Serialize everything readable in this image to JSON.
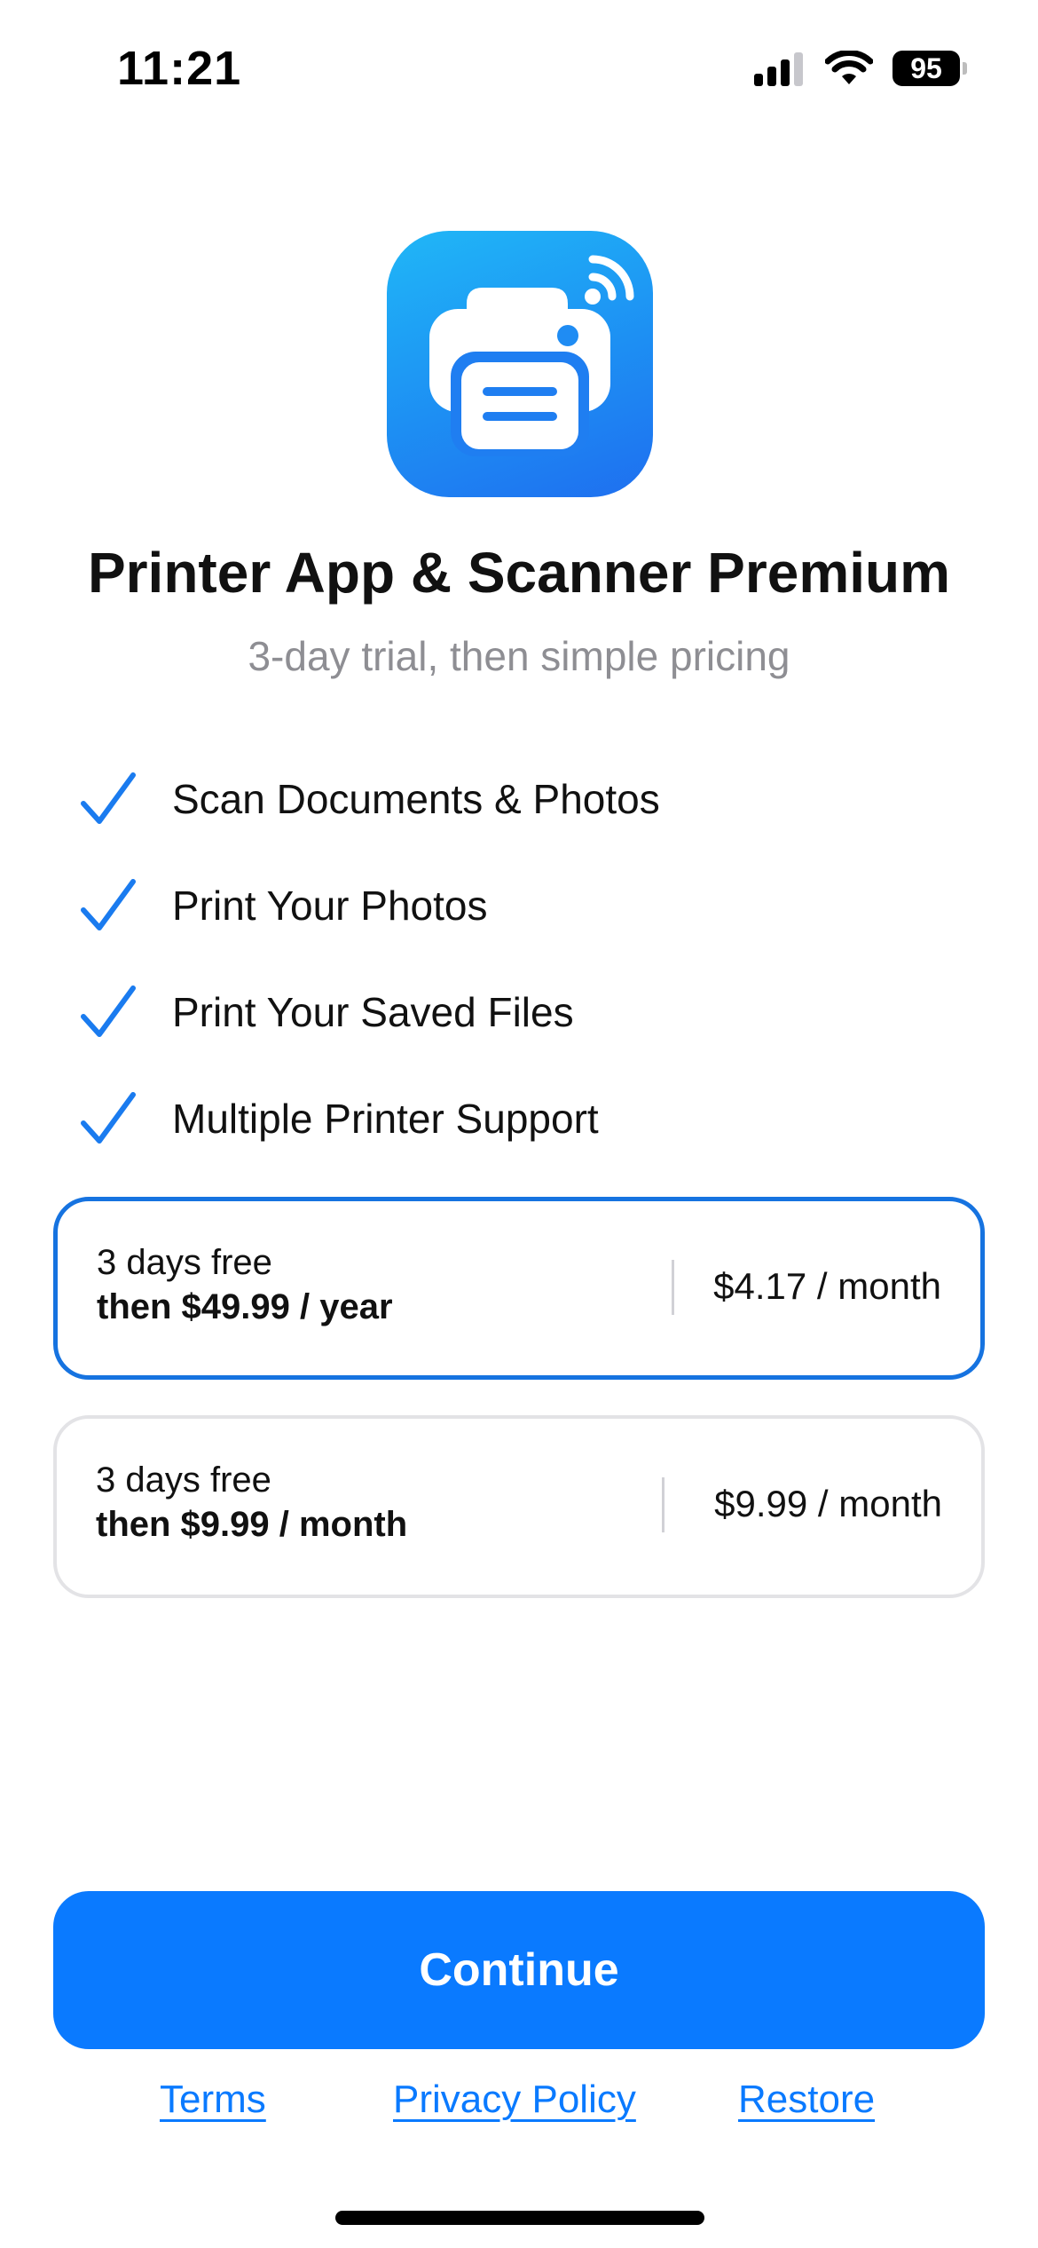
{
  "status_bar": {
    "time": "11:21",
    "battery": "95",
    "icons": [
      "signal-icon",
      "wifi-icon",
      "battery-icon"
    ]
  },
  "app": {
    "icon": "printer-wifi-icon",
    "title": "Printer App & Scanner Premium",
    "subtitle": "3-day trial, then simple pricing"
  },
  "features": [
    {
      "label": "Scan Documents & Photos"
    },
    {
      "label": "Print Your Photos"
    },
    {
      "label": "Print Your Saved Files"
    },
    {
      "label": "Multiple Printer Support"
    }
  ],
  "plans": [
    {
      "trial": "3 days free",
      "price": "then $49.99 / year",
      "monthly": "$4.17 / month",
      "selected": true
    },
    {
      "trial": "3 days free",
      "price": "then $9.99 / month",
      "monthly": "$9.99 / month",
      "selected": false
    }
  ],
  "continue_label": "Continue",
  "footer": {
    "terms": "Terms",
    "privacy": "Privacy Policy",
    "restore": "Restore"
  },
  "colors": {
    "accent": "#0A7AFF",
    "selected_border": "#1673E0",
    "subtitle": "#8E8E93"
  }
}
